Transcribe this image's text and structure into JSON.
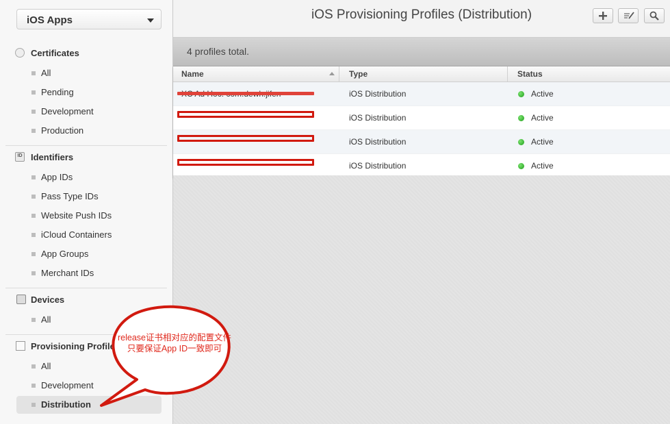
{
  "sidebar": {
    "app_selector": "iOS Apps",
    "sections": [
      {
        "title": "Certificates",
        "icon": "certificate-icon",
        "items": [
          "All",
          "Pending",
          "Development",
          "Production"
        ]
      },
      {
        "title": "Identifiers",
        "icon": "id-badge-icon",
        "items": [
          "App IDs",
          "Pass Type IDs",
          "Website Push IDs",
          "iCloud Containers",
          "App Groups",
          "Merchant IDs"
        ]
      },
      {
        "title": "Devices",
        "icon": "device-icon",
        "items": [
          "All"
        ]
      },
      {
        "title": "Provisioning Profiles",
        "icon": "document-icon",
        "items": [
          "All",
          "Development",
          "Distribution"
        ]
      }
    ],
    "selected": "Distribution"
  },
  "header": {
    "title": "iOS Provisioning Profiles (Distribution)",
    "tools": [
      "add-icon",
      "edit-icon",
      "search-icon"
    ]
  },
  "summary": "4 profiles total.",
  "table": {
    "columns": [
      "Name",
      "Type",
      "Status"
    ],
    "sort_column": "Name",
    "rows": [
      {
        "name": "XC Ad Hoc: com.dewh.jifen",
        "type": "iOS Distribution",
        "status": "Active"
      },
      {
        "name": "",
        "type": "iOS Distribution",
        "status": "Active"
      },
      {
        "name": "",
        "type": "iOS Distribution",
        "status": "Active"
      },
      {
        "name": "",
        "type": "iOS Distribution",
        "status": "Active"
      }
    ],
    "status_color": "#2aaa22"
  },
  "annotation": {
    "text": "release证书相对应的配置文件只要保证App ID一致即可",
    "color": "#d11a0f"
  }
}
